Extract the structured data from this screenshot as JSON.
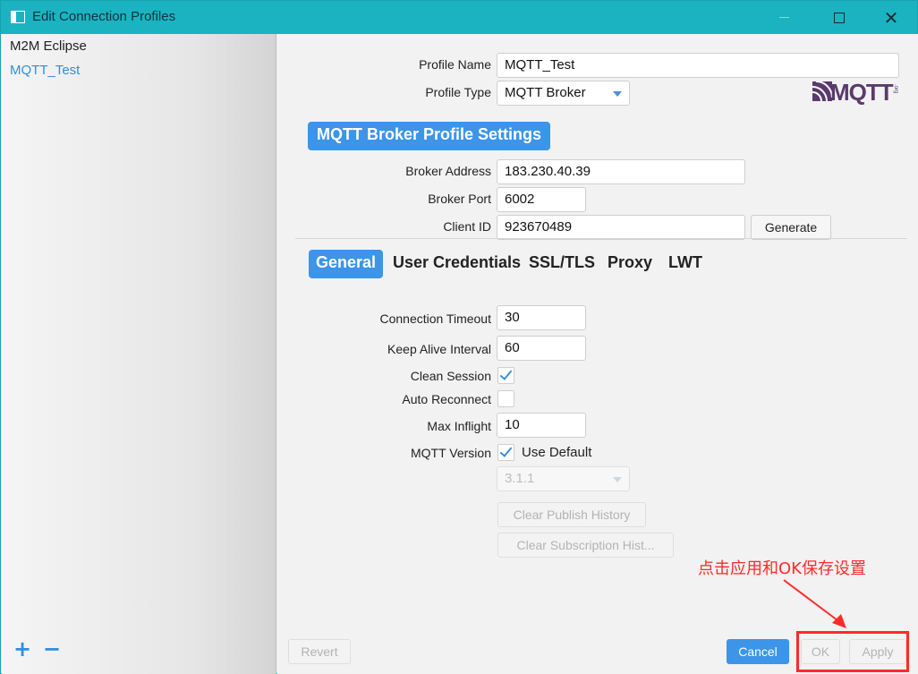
{
  "window": {
    "title": "Edit Connection Profiles",
    "close_glyph": "✕"
  },
  "sidebar": {
    "profiles": [
      {
        "label": "M2M Eclipse"
      },
      {
        "label": "MQTT_Test"
      }
    ],
    "add_label": "+",
    "remove_label": "−"
  },
  "profile": {
    "name_label": "Profile Name",
    "name_value": "MQTT_Test",
    "type_label": "Profile Type",
    "type_value": "MQTT Broker"
  },
  "logo": {
    "text": "MQTT",
    "sub": ".org"
  },
  "broker": {
    "section_title": "MQTT Broker Profile Settings",
    "address_label": "Broker Address",
    "address_value": "183.230.40.39",
    "port_label": "Broker Port",
    "port_value": "6002",
    "client_id_label": "Client ID",
    "client_id_value": "923670489",
    "generate_label": "Generate"
  },
  "tabs": [
    {
      "label": "General",
      "active": true
    },
    {
      "label": "User Credentials",
      "active": false
    },
    {
      "label": "SSL/TLS",
      "active": false
    },
    {
      "label": "Proxy",
      "active": false
    },
    {
      "label": "LWT",
      "active": false
    }
  ],
  "general": {
    "timeout_label": "Connection Timeout",
    "timeout_value": "30",
    "keepalive_label": "Keep Alive Interval",
    "keepalive_value": "60",
    "clean_session_label": "Clean Session",
    "clean_session_checked": true,
    "auto_reconnect_label": "Auto Reconnect",
    "auto_reconnect_checked": false,
    "max_inflight_label": "Max Inflight",
    "max_inflight_value": "10",
    "mqtt_version_label": "MQTT Version",
    "use_default_label": "Use Default",
    "use_default_checked": true,
    "version_value": "3.1.1",
    "clear_publish_label": "Clear Publish History",
    "clear_subscription_label": "Clear Subscription Hist..."
  },
  "footer": {
    "revert_label": "Revert",
    "cancel_label": "Cancel",
    "ok_label": "OK",
    "apply_label": "Apply"
  },
  "annotation": {
    "text": "点击应用和OK保存设置",
    "color": "#ff2a2a"
  },
  "colors": {
    "titlebar": "#1bb3c1",
    "accent": "#3c95e8"
  }
}
